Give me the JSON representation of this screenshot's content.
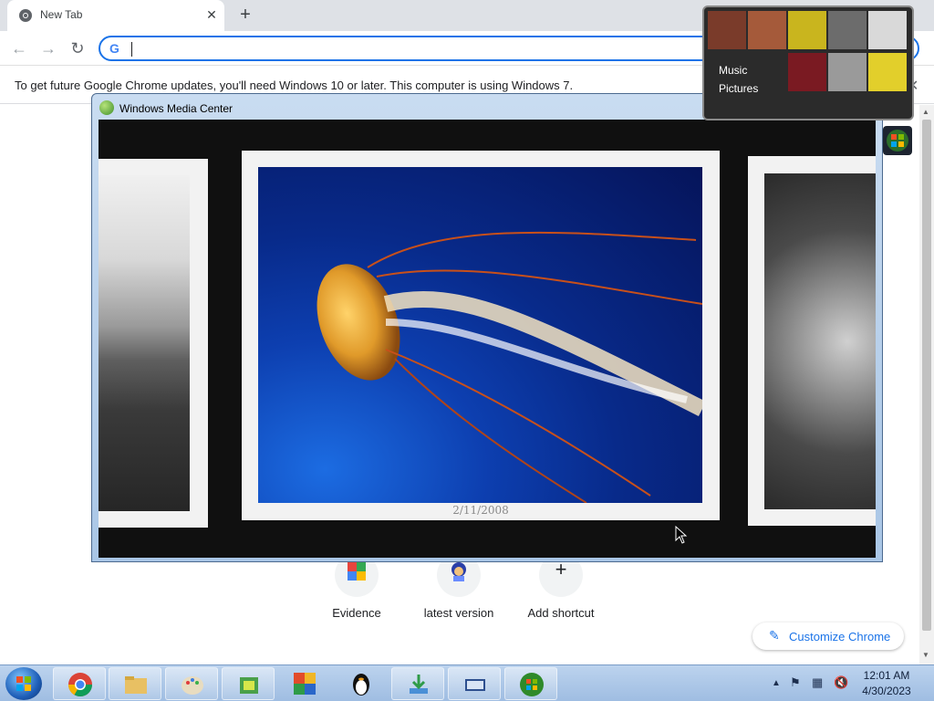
{
  "browser": {
    "tab_title": "New Tab",
    "new_tab_symbol": "+",
    "close_symbol": "✕",
    "omnibox_value": "",
    "info_message": "To get future Google Chrome updates, you'll need Windows 10 or later. This computer is using Windows 7."
  },
  "new_tab_page": {
    "shortcuts": [
      {
        "label": "Evidence",
        "icon": "evidence-icon"
      },
      {
        "label": "latest version",
        "icon": "latest-version-icon"
      },
      {
        "label": "Add shortcut",
        "icon": "plus-icon"
      }
    ],
    "customize_label": "Customize Chrome",
    "add_symbol": "+"
  },
  "media_center": {
    "window_title": "Windows Media Center",
    "photo_date": "2/11/2008",
    "photos": [
      "seascape-bw",
      "jellyfish",
      "face-bw"
    ]
  },
  "gadget": {
    "items": [
      "Music",
      "Pictures"
    ]
  },
  "taskbar": {
    "pinned": [
      "chrome",
      "explorer",
      "paint",
      "app-tool",
      "colorful-app",
      "penguin-app",
      "download-app",
      "keyboard-app",
      "media-center"
    ],
    "clock_time": "12:01 AM",
    "clock_date": "4/30/2023"
  },
  "colors": {
    "accent": "#1a73e8",
    "wmc_client": "#101010",
    "taskbar": "#a9c4e6"
  }
}
